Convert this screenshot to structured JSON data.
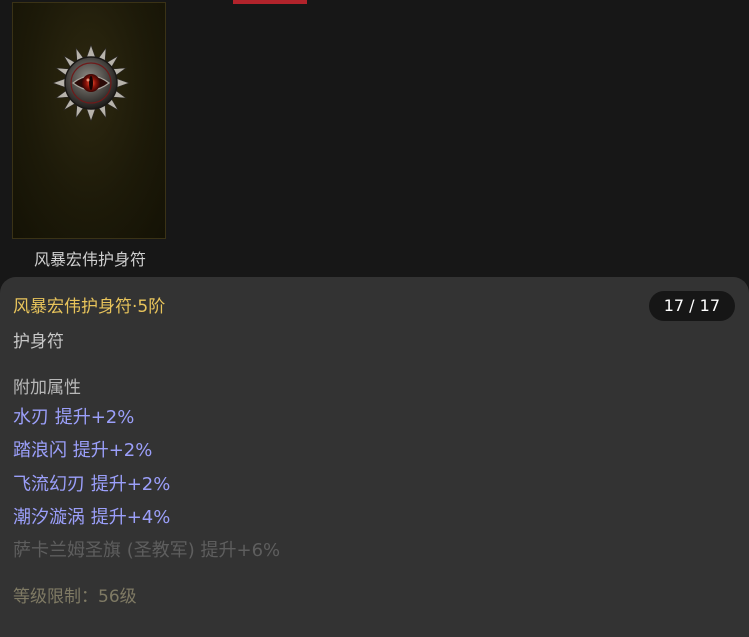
{
  "item": {
    "caption": "风暴宏伟护身符",
    "icon": "amulet-eye-icon",
    "full_name": "风暴宏伟护身符·5阶",
    "count": "17 / 17",
    "type": "护身符",
    "attr_header": "附加属性",
    "attributes": [
      {
        "text": "水刃 提升+2%",
        "active": true
      },
      {
        "text": "踏浪闪 提升+2%",
        "active": true
      },
      {
        "text": "飞流幻刃 提升+2%",
        "active": true
      },
      {
        "text": "潮汐漩涡 提升+4%",
        "active": true
      },
      {
        "text": "萨卡兰姆圣旗 (圣教军) 提升+6%",
        "active": false
      }
    ],
    "level_requirement": "等级限制：56级"
  },
  "colors": {
    "background": "#171717",
    "panel": "#333333",
    "item_name": "#e8c45b",
    "attribute_active": "#9b9ffa",
    "attribute_inactive": "#5e5e5e",
    "accent": "#b1232b"
  }
}
